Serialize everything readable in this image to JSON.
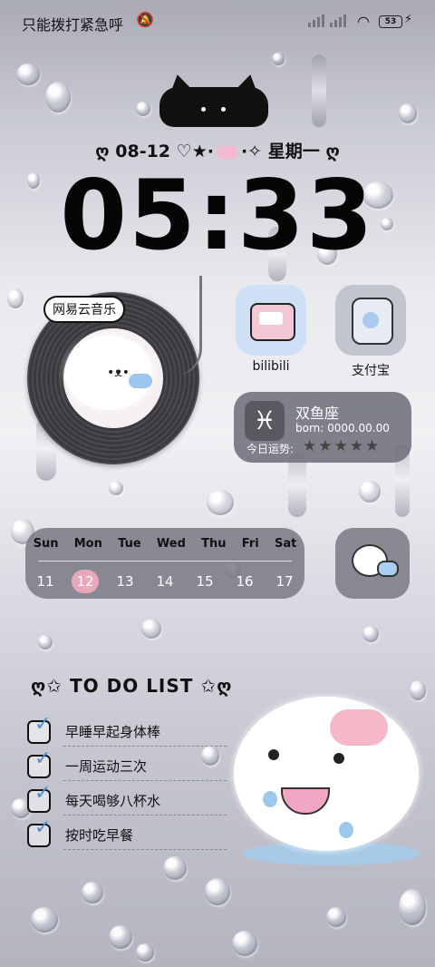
{
  "status_bar": {
    "carrier": "只能拨打紧急呼",
    "battery": "53"
  },
  "date": {
    "day": "08-12",
    "weekday": "星期一"
  },
  "clock": {
    "time": "05:33"
  },
  "music_widget": {
    "label": "网易云音乐"
  },
  "apps": [
    {
      "label": "bilibili"
    },
    {
      "label": "支付宝"
    }
  ],
  "horoscope": {
    "sign": "双鱼座",
    "glyph": "♓",
    "born": "born: 0000.00.00",
    "fortune_label": "今日运势:",
    "stars": "★★★★★"
  },
  "calendar": {
    "weekdays": [
      "Sun",
      "Mon",
      "Tue",
      "Wed",
      "Thu",
      "Fri",
      "Sat"
    ],
    "dates": [
      "11",
      "12",
      "13",
      "14",
      "15",
      "16",
      "17"
    ],
    "today_index": 1
  },
  "todo": {
    "title": "TO DO LIST",
    "items": [
      "早睡早起身体棒",
      "一周运动三次",
      "每天喝够八杯水",
      "按时吃早餐"
    ]
  }
}
